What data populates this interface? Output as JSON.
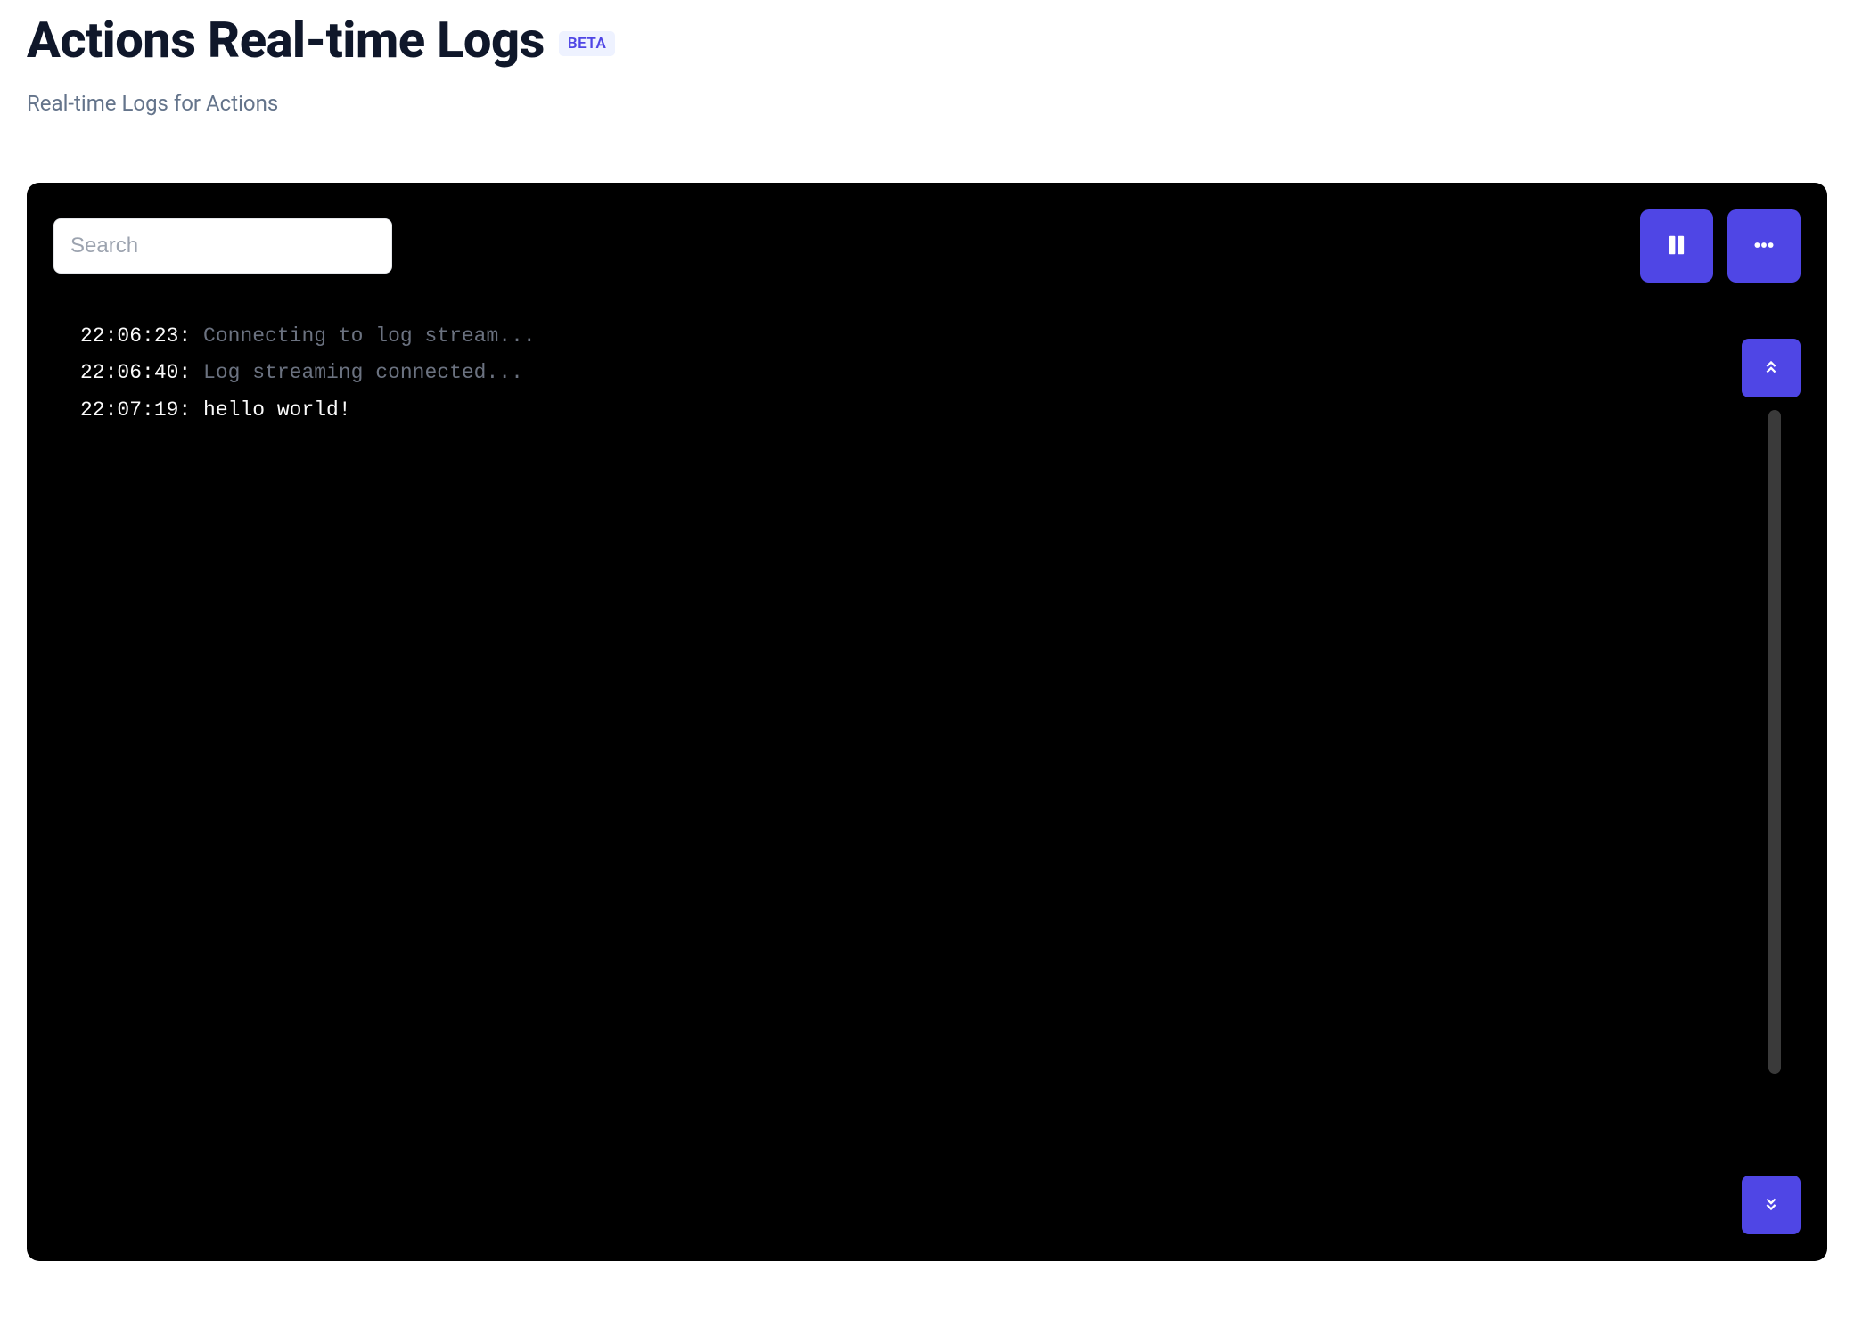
{
  "header": {
    "title": "Actions Real-time Logs",
    "badge": "BETA",
    "subtitle": "Real-time Logs for Actions"
  },
  "toolbar": {
    "search_placeholder": "Search",
    "search_value": ""
  },
  "logs": [
    {
      "time": "22:06:23",
      "message": "Connecting to log stream...",
      "dim": true
    },
    {
      "time": "22:06:40",
      "message": "Log streaming connected...",
      "dim": true
    },
    {
      "time": "22:07:19",
      "message": "hello world!",
      "dim": false
    }
  ],
  "icons": {
    "pause": "pause-icon",
    "more": "more-horizontal-icon",
    "scroll_up": "chevrons-up-icon",
    "scroll_down": "chevrons-down-icon"
  },
  "colors": {
    "accent": "#4f46e5",
    "console_bg": "#000000",
    "dim_text": "#6b7280"
  }
}
